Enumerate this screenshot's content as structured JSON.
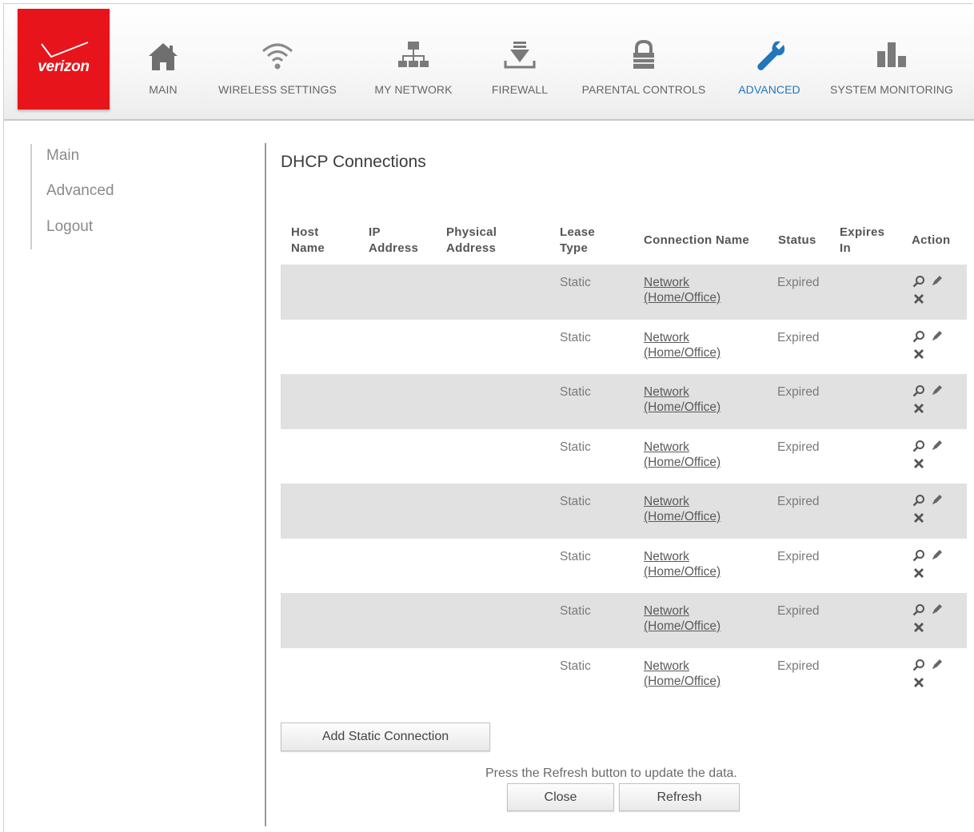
{
  "brand": {
    "logo_text": "verizon",
    "color": "#e8141b"
  },
  "nav": {
    "active_color": "#2276bb",
    "items": [
      {
        "label": "MAIN",
        "icon": "home-icon"
      },
      {
        "label": "WIRELESS SETTINGS",
        "icon": "wifi-icon"
      },
      {
        "label": "MY NETWORK",
        "icon": "network-icon"
      },
      {
        "label": "FIREWALL",
        "icon": "firewall-icon"
      },
      {
        "label": "PARENTAL CONTROLS",
        "icon": "lock-icon"
      },
      {
        "label": "ADVANCED",
        "icon": "wrench-icon"
      },
      {
        "label": "SYSTEM MONITORING",
        "icon": "bar-chart-icon"
      }
    ]
  },
  "sidebar": {
    "items": [
      "Main",
      "Advanced",
      "Logout"
    ]
  },
  "page": {
    "title": "DHCP Connections"
  },
  "table": {
    "headers": {
      "host_name": [
        "Host",
        "Name"
      ],
      "ip_address": [
        "IP",
        "Address"
      ],
      "physical_address": [
        "Physical",
        "Address"
      ],
      "lease_type": [
        "Lease",
        "Type"
      ],
      "connection_name": "Connection Name",
      "status": "Status",
      "expires_in": [
        "Expires",
        "In"
      ],
      "action": "Action"
    },
    "rows": [
      {
        "host_name": "",
        "ip_address": "",
        "physical_address": "",
        "lease_type": "Static",
        "connection_name": [
          "Network",
          "(Home/Office)"
        ],
        "status": "Expired",
        "expires_in": ""
      },
      {
        "host_name": "",
        "ip_address": "",
        "physical_address": "",
        "lease_type": "Static",
        "connection_name": [
          "Network",
          "(Home/Office)"
        ],
        "status": "Expired",
        "expires_in": ""
      },
      {
        "host_name": "",
        "ip_address": "",
        "physical_address": "",
        "lease_type": "Static",
        "connection_name": [
          "Network",
          "(Home/Office)"
        ],
        "status": "Expired",
        "expires_in": ""
      },
      {
        "host_name": "",
        "ip_address": "",
        "physical_address": "",
        "lease_type": "Static",
        "connection_name": [
          "Network",
          "(Home/Office)"
        ],
        "status": "Expired",
        "expires_in": ""
      },
      {
        "host_name": "",
        "ip_address": "",
        "physical_address": "",
        "lease_type": "Static",
        "connection_name": [
          "Network",
          "(Home/Office)"
        ],
        "status": "Expired",
        "expires_in": ""
      },
      {
        "host_name": "",
        "ip_address": "",
        "physical_address": "",
        "lease_type": "Static",
        "connection_name": [
          "Network",
          "(Home/Office)"
        ],
        "status": "Expired",
        "expires_in": ""
      },
      {
        "host_name": "",
        "ip_address": "",
        "physical_address": "",
        "lease_type": "Static",
        "connection_name": [
          "Network",
          "(Home/Office)"
        ],
        "status": "Expired",
        "expires_in": ""
      },
      {
        "host_name": "",
        "ip_address": "",
        "physical_address": "",
        "lease_type": "Static",
        "connection_name": [
          "Network",
          "(Home/Office)"
        ],
        "status": "Expired",
        "expires_in": ""
      }
    ],
    "row_actions": [
      "view-icon",
      "edit-icon",
      "delete-icon"
    ]
  },
  "buttons": {
    "add_static": "Add Static Connection",
    "close": "Close",
    "refresh": "Refresh"
  },
  "refresh_note": "Press the Refresh button to update the data."
}
